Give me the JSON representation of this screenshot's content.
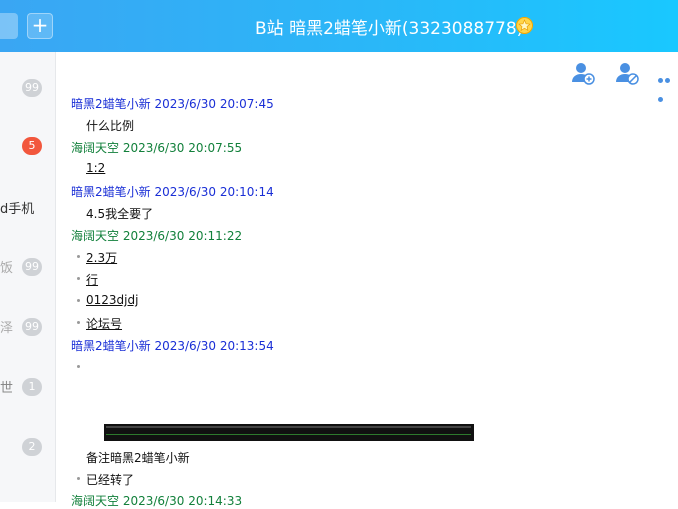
{
  "header": {
    "add_symbol": "+",
    "title": "B站 暗黑2蜡笔小新(3323088778)",
    "badge_icon": "star-badge-icon"
  },
  "sidebar": {
    "items": [
      {
        "text": "",
        "badge": "99",
        "badge_color": "#cfd2d6"
      },
      {
        "text": "",
        "badge": "5",
        "badge_color": "#f2573d"
      },
      {
        "text": "d手机",
        "badge": ""
      },
      {
        "text": "饭",
        "badge": "99",
        "badge_color": "#cfd2d6"
      },
      {
        "text": "泽",
        "badge": "99",
        "badge_color": "#cfd2d6"
      },
      {
        "text": "世",
        "badge": "1",
        "badge_color": "#cfd2d6"
      },
      {
        "text": "",
        "badge": "2",
        "badge_color": "#cfd2d6"
      }
    ]
  },
  "toolbar": {
    "add_member_icon": "add-user-icon",
    "block_user_icon": "block-user-icon",
    "more_icon": "more-icon"
  },
  "messages": [
    {
      "sender": "暗黑2蜡笔小新",
      "time": "2023/6/30 20:07:45",
      "role": "me",
      "lines": [
        "什么比例"
      ]
    },
    {
      "sender": "海阔天空",
      "time": "2023/6/30 20:07:55",
      "role": "other",
      "lines": [
        "1:2"
      ]
    },
    {
      "sender": "暗黑2蜡笔小新",
      "time": "2023/6/30 20:10:14",
      "role": "me",
      "lines": [
        "4.5我全要了"
      ]
    },
    {
      "sender": "海阔天空",
      "time": "2023/6/30 20:11:22",
      "role": "other",
      "lines": [
        "2.3万",
        "行",
        "0123djdj",
        "论坛号"
      ]
    },
    {
      "sender": "暗黑2蜡笔小新",
      "time": "2023/6/30 20:13:54",
      "role": "me",
      "lines": [
        "备注暗黑2蜡笔小新",
        "已经转了"
      ]
    },
    {
      "sender": "海阔天空",
      "time": "2023/6/30 20:14:33",
      "role": "other",
      "lines": []
    }
  ],
  "colors": {
    "header_start": "#3aa6f3",
    "header_end": "#19c8ff",
    "self_name": "#1a2fd6",
    "other_name": "#12803b"
  }
}
